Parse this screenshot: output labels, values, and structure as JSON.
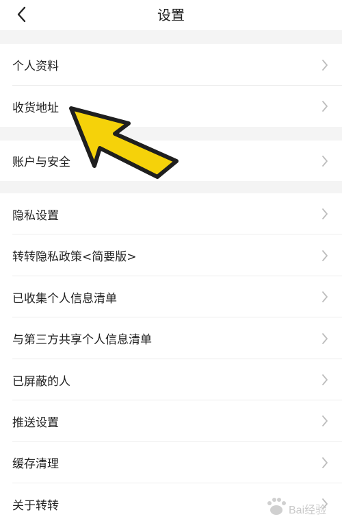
{
  "header": {
    "title": "设置",
    "back_icon": "chevron-left-icon"
  },
  "sections": [
    [
      {
        "label": "个人资料"
      },
      {
        "label": "收货地址"
      }
    ],
    [
      {
        "label": "账户与安全"
      }
    ],
    [
      {
        "label": "隐私设置"
      },
      {
        "label": "转转隐私政策<简要版>"
      },
      {
        "label": "已收集个人信息清单"
      },
      {
        "label": "与第三方共享个人信息清单"
      },
      {
        "label": "已屏蔽的人"
      },
      {
        "label": "推送设置"
      },
      {
        "label": "缓存清理"
      },
      {
        "label": "关于转转"
      }
    ]
  ],
  "overlay": {
    "arrow_color": "#f5d20a",
    "arrow_icon": "pointer-arrow-icon"
  },
  "watermark": {
    "text": "Bai经验"
  },
  "colors": {
    "background": "#ffffff",
    "section_gap": "#f4f4f4",
    "chevron": "#bdbdbd"
  }
}
